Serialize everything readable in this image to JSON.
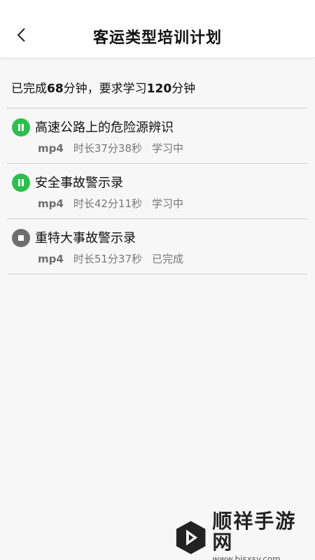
{
  "header": {
    "title": "客运类型培训计划",
    "back_icon": "chevron-left-icon"
  },
  "summary": {
    "prefix": "已完成",
    "completed": "68",
    "completed_unit": "分钟，",
    "required_prefix": "要求学习",
    "required": "120",
    "required_unit": "分钟"
  },
  "courses": [
    {
      "title": "高速公路上的危险源辨识",
      "format": "mp4",
      "duration": "时长37分38秒",
      "status": "学习中",
      "icon": "pause-icon",
      "icon_color": "#2dbe4f"
    },
    {
      "title": "安全事故警示录",
      "format": "mp4",
      "duration": "时长42分11秒",
      "status": "学习中",
      "icon": "pause-icon",
      "icon_color": "#2dbe4f"
    },
    {
      "title": "重特大事故警示录",
      "format": "mp4",
      "duration": "时长51分37秒",
      "status": "已完成",
      "icon": "stop-icon",
      "icon_color": "#6e6e6e"
    }
  ],
  "watermark": {
    "name": "顺祥手游网",
    "url": "www.bjsxsy.com"
  }
}
